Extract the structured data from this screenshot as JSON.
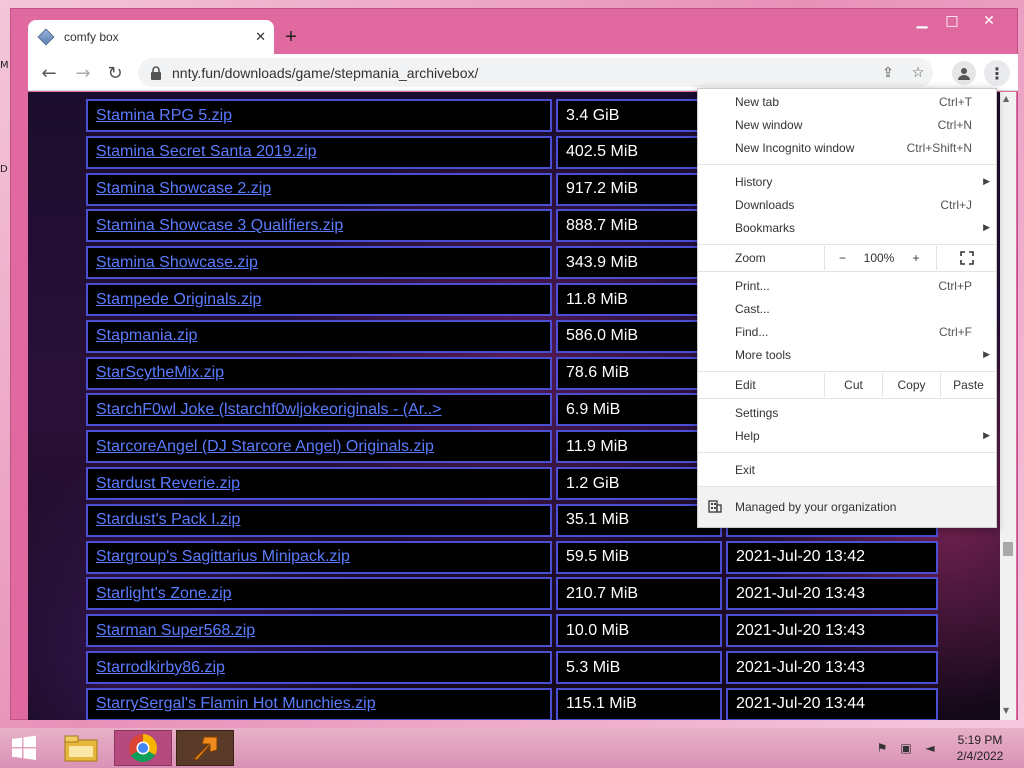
{
  "desktop": {
    "edge_letters": [
      "M",
      "D"
    ]
  },
  "window": {
    "minimize": "▁",
    "maximize": "□",
    "close": "✕"
  },
  "tab": {
    "title": "comfy box",
    "close": "✕",
    "new_tab": "+"
  },
  "toolbar": {
    "back": "←",
    "forward": "→",
    "reload": "↻",
    "url": "nnty.fun/downloads/game/stepmania_archivebox/",
    "share": "⇪",
    "star": "☆",
    "menu": "⋮"
  },
  "files": [
    {
      "name": "Stamina RPG 5.zip",
      "size": "3.4 GiB",
      "date": ""
    },
    {
      "name": "Stamina Secret Santa 2019.zip",
      "size": "402.5 MiB",
      "date": ""
    },
    {
      "name": "Stamina Showcase 2.zip",
      "size": "917.2 MiB",
      "date": ""
    },
    {
      "name": "Stamina Showcase 3 Qualifiers.zip",
      "size": "888.7 MiB",
      "date": ""
    },
    {
      "name": "Stamina Showcase.zip",
      "size": "343.9 MiB",
      "date": ""
    },
    {
      "name": "Stampede Originals.zip",
      "size": "11.8 MiB",
      "date": ""
    },
    {
      "name": "Stapmania.zip",
      "size": "586.0 MiB",
      "date": ""
    },
    {
      "name": "StarScytheMix.zip",
      "size": "78.6 MiB",
      "date": ""
    },
    {
      "name": "StarchF0wl Joke (lstarchf0wljokeoriginals - (Ar..>",
      "size": "6.9 MiB",
      "date": ""
    },
    {
      "name": "StarcoreAngel (DJ Starcore Angel) Originals.zip",
      "size": "11.9 MiB",
      "date": ""
    },
    {
      "name": "Stardust Reverie.zip",
      "size": "1.2 GiB",
      "date": ""
    },
    {
      "name": "Stardust's Pack I.zip",
      "size": "35.1 MiB",
      "date": ""
    },
    {
      "name": "Stargroup's Sagittarius Minipack.zip",
      "size": "59.5 MiB",
      "date": "2021-Jul-20 13:42"
    },
    {
      "name": "Starlight's Zone.zip",
      "size": "210.7 MiB",
      "date": "2021-Jul-20 13:43"
    },
    {
      "name": "Starman Super568.zip",
      "size": "10.0 MiB",
      "date": "2021-Jul-20 13:43"
    },
    {
      "name": "Starrodkirby86.zip",
      "size": "5.3 MiB",
      "date": "2021-Jul-20 13:43"
    },
    {
      "name": "StarrySergal's Flamin Hot Munchies.zip",
      "size": "115.1 MiB",
      "date": "2021-Jul-20 13:44"
    }
  ],
  "menu": {
    "new_tab": {
      "label": "New tab",
      "shortcut": "Ctrl+T"
    },
    "new_window": {
      "label": "New window",
      "shortcut": "Ctrl+N"
    },
    "incognito": {
      "label": "New Incognito window",
      "shortcut": "Ctrl+Shift+N"
    },
    "history": {
      "label": "History"
    },
    "downloads": {
      "label": "Downloads",
      "shortcut": "Ctrl+J"
    },
    "bookmarks": {
      "label": "Bookmarks"
    },
    "zoom": {
      "label": "Zoom",
      "minus": "−",
      "value": "100%",
      "plus": "+"
    },
    "print": {
      "label": "Print...",
      "shortcut": "Ctrl+P"
    },
    "cast": {
      "label": "Cast..."
    },
    "find": {
      "label": "Find...",
      "shortcut": "Ctrl+F"
    },
    "more_tools": {
      "label": "More tools"
    },
    "edit": {
      "label": "Edit",
      "cut": "Cut",
      "copy": "Copy",
      "paste": "Paste"
    },
    "settings": {
      "label": "Settings"
    },
    "help": {
      "label": "Help"
    },
    "exit": {
      "label": "Exit"
    },
    "managed": {
      "label": "Managed by your organization"
    }
  },
  "taskbar": {
    "time": "5:19 PM",
    "date": "2/4/2022"
  }
}
